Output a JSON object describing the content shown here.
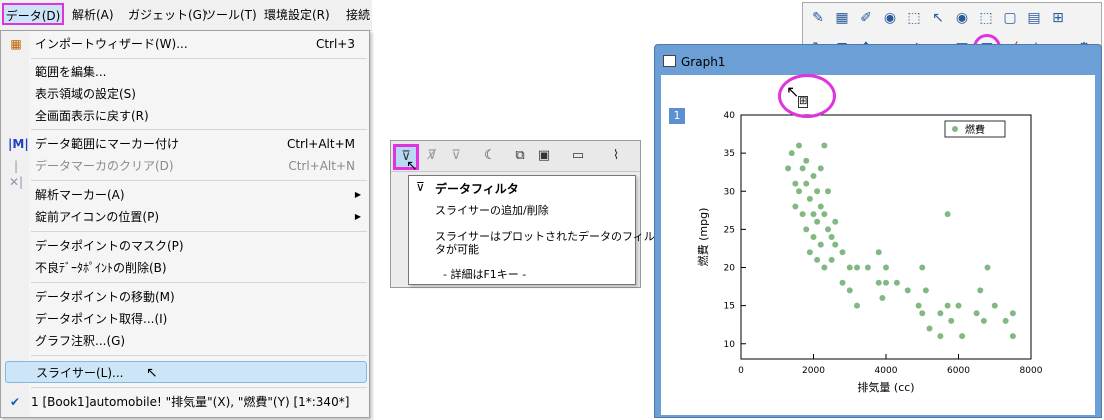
{
  "menubar": {
    "items": [
      "データ(D)",
      "解析(A)",
      "ガジェット(G)",
      "ツール(T)",
      "環境設定(R)",
      "接続"
    ]
  },
  "menu": {
    "items": [
      {
        "label": "インポートウィザード(W)...",
        "shortcut": "Ctrl+3",
        "icon": "import-wizard-icon"
      },
      {
        "label": "範囲を編集..."
      },
      {
        "label": "表示領域の設定(S)"
      },
      {
        "label": "全画面表示に戻す(R)"
      },
      {
        "label": "データ範囲にマーカー付け",
        "shortcut": "Ctrl+Alt+M",
        "icon": "marker-icon"
      },
      {
        "label": "データマーカのクリア(D)",
        "shortcut": "Ctrl+Alt+N",
        "icon": "clear-marker-icon",
        "disabled": true
      },
      {
        "label": "解析マーカー(A)",
        "submenu": true
      },
      {
        "label": "錠前アイコンの位置(P)",
        "submenu": true
      },
      {
        "label": "データポイントのマスク(P)"
      },
      {
        "label": "不良ﾃﾞｰﾀﾎﾟｲﾝﾄの削除(B)"
      },
      {
        "label": "データポイントの移動(M)"
      },
      {
        "label": "データポイント取得...(I)"
      },
      {
        "label": "グラフ注釈...(G)"
      },
      {
        "label": "スライサー(L)...",
        "highlighted": true
      },
      {
        "label": "1   [Book1]automobile! \"排気量\"(X), \"燃費\"(Y) [1*:340*]",
        "checked": true
      }
    ]
  },
  "tooltip": {
    "title": "データフィルタ",
    "line1": "スライサーの追加/削除",
    "line2a": "スライサーはプロットされたデータのフィル",
    "line2b": "タが可能",
    "line3": "- 詳細はF1キー -"
  },
  "graph": {
    "window_title": "Graph1",
    "layer_number": "1",
    "accent_color": "#e033e0"
  },
  "chart_data": {
    "type": "scatter",
    "xlabel": "排気量 (cc)",
    "ylabel": "燃費 (mpg)",
    "xlim": [
      0,
      8000
    ],
    "ylim": [
      8,
      40
    ],
    "xticks": [
      "0",
      "2000",
      "4000",
      "6000",
      "8000"
    ],
    "yticks": [
      "10",
      "15",
      "20",
      "25",
      "30",
      "35",
      "40"
    ],
    "legend": "燃費",
    "legend_position": "top-right",
    "marker_color": "#2e8b2e",
    "series": [
      {
        "name": "燃費",
        "points": [
          [
            1300,
            33
          ],
          [
            1400,
            35
          ],
          [
            1500,
            31
          ],
          [
            1500,
            28
          ],
          [
            1600,
            36
          ],
          [
            1600,
            30
          ],
          [
            1700,
            33
          ],
          [
            1700,
            27
          ],
          [
            1800,
            34
          ],
          [
            1800,
            31
          ],
          [
            1800,
            25
          ],
          [
            1900,
            29
          ],
          [
            1900,
            22
          ],
          [
            2000,
            32
          ],
          [
            2000,
            27
          ],
          [
            2000,
            24
          ],
          [
            2100,
            30
          ],
          [
            2100,
            26
          ],
          [
            2100,
            21
          ],
          [
            2200,
            33
          ],
          [
            2200,
            28
          ],
          [
            2200,
            23
          ],
          [
            2300,
            36
          ],
          [
            2300,
            27
          ],
          [
            2300,
            20
          ],
          [
            2400,
            30
          ],
          [
            2400,
            25
          ],
          [
            2500,
            24
          ],
          [
            2500,
            21
          ],
          [
            2600,
            26
          ],
          [
            2600,
            23
          ],
          [
            2800,
            22
          ],
          [
            2800,
            18
          ],
          [
            3000,
            20
          ],
          [
            3000,
            17
          ],
          [
            3200,
            20
          ],
          [
            3200,
            15
          ],
          [
            3500,
            20
          ],
          [
            3800,
            22
          ],
          [
            3800,
            18
          ],
          [
            3900,
            16
          ],
          [
            4000,
            20
          ],
          [
            4000,
            18
          ],
          [
            4300,
            18
          ],
          [
            4600,
            17
          ],
          [
            4900,
            15
          ],
          [
            5000,
            14
          ],
          [
            5000,
            20
          ],
          [
            5100,
            17
          ],
          [
            5200,
            12
          ],
          [
            5500,
            14
          ],
          [
            5500,
            11
          ],
          [
            5700,
            27
          ],
          [
            5700,
            15
          ],
          [
            5800,
            13
          ],
          [
            6000,
            15
          ],
          [
            6100,
            11
          ],
          [
            6500,
            14
          ],
          [
            6600,
            17
          ],
          [
            6700,
            13
          ],
          [
            6800,
            20
          ],
          [
            7000,
            15
          ],
          [
            7300,
            13
          ],
          [
            7500,
            14
          ],
          [
            7500,
            11
          ]
        ]
      }
    ]
  }
}
